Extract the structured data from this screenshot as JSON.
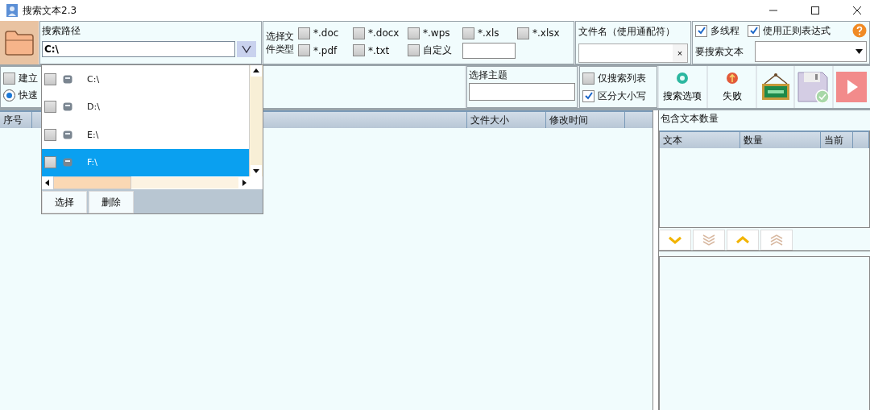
{
  "window": {
    "title": "搜索文本2.3"
  },
  "search_path": {
    "label": "搜索路径",
    "value": "C:\\"
  },
  "path_dropdown": {
    "expanded": true,
    "items": [
      {
        "label": "C:\\",
        "checked": false,
        "selected": false
      },
      {
        "label": "D:\\",
        "checked": false,
        "selected": false
      },
      {
        "label": "E:\\",
        "checked": false,
        "selected": false
      },
      {
        "label": "F:\\",
        "checked": false,
        "selected": true
      }
    ],
    "buttons": [
      "选择",
      "删除"
    ]
  },
  "file_types": {
    "label": "选择文件类型",
    "types": [
      {
        "label": "*.doc",
        "checked": false
      },
      {
        "label": "*.docx",
        "checked": false
      },
      {
        "label": "*.wps",
        "checked": false
      },
      {
        "label": "*.xls",
        "checked": false
      },
      {
        "label": "*.xlsx",
        "checked": false
      },
      {
        "label": "*.pdf",
        "checked": false
      },
      {
        "label": "*.txt",
        "checked": false
      },
      {
        "label": "自定义",
        "checked": false
      }
    ]
  },
  "filename": {
    "label": "文件名（使用通配符）",
    "clear": "×"
  },
  "options": {
    "checks": [
      {
        "label": "多线程",
        "checked": true
      },
      {
        "label": "使用正则表达式",
        "checked": true
      }
    ],
    "search_text_label": "要搜索文本"
  },
  "index_options": {
    "check": {
      "label": "建立",
      "checked": false
    },
    "radio": {
      "label": "快速",
      "selected": true
    }
  },
  "subject": {
    "label": "选择主题"
  },
  "filters": [
    {
      "label": "仅搜索列表",
      "checked": false
    },
    {
      "label": "区分大小写",
      "checked": true
    }
  ],
  "toolbar": [
    {
      "kind": "options",
      "label": "搜索选项"
    },
    {
      "kind": "fail",
      "label": "失败"
    },
    {
      "kind": "open"
    },
    {
      "kind": "save"
    },
    {
      "kind": "run"
    }
  ],
  "results": {
    "columns": [
      "序号",
      "文件大小",
      "修改时间"
    ]
  },
  "counts": {
    "label": "包含文本数量",
    "columns": [
      "文本",
      "数量",
      "当前"
    ]
  },
  "nav_buttons": [
    {
      "kind": "down"
    },
    {
      "kind": "down_all"
    },
    {
      "kind": "up"
    },
    {
      "kind": "up_all"
    }
  ]
}
